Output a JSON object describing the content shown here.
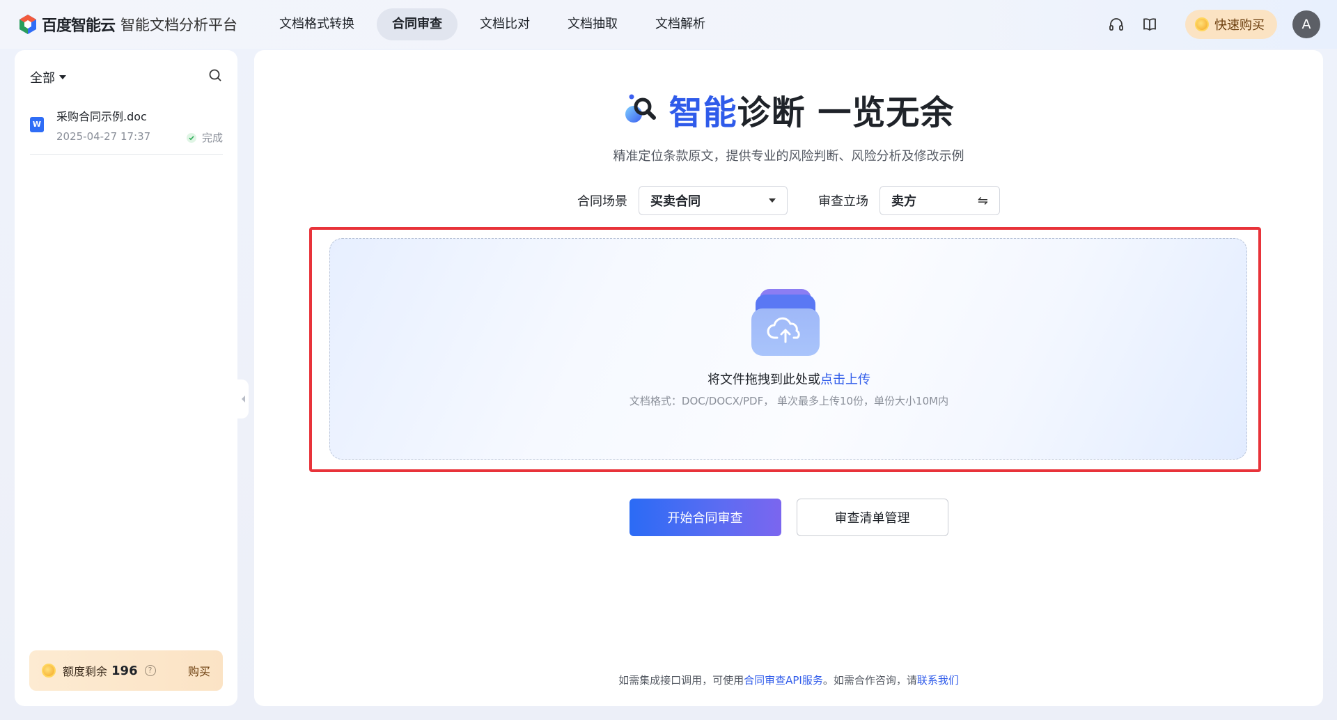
{
  "header": {
    "brand_name": "百度智能云",
    "brand_sub": "智能文档分析平台",
    "nav": [
      {
        "label": "文档格式转换",
        "active": false
      },
      {
        "label": "合同审查",
        "active": true
      },
      {
        "label": "文档比对",
        "active": false
      },
      {
        "label": "文档抽取",
        "active": false
      },
      {
        "label": "文档解析",
        "active": false
      }
    ],
    "icons": [
      "headset-icon",
      "book-icon"
    ],
    "buy_label": "快速购买",
    "avatar_letter": "A"
  },
  "sidebar": {
    "filter_label": "全部",
    "documents": [
      {
        "name": "采购合同示例.doc",
        "time": "2025-04-27 17:37",
        "status": "完成",
        "type_badge": "W"
      }
    ],
    "quota": {
      "label": "额度剩余",
      "value": "196",
      "buy_label": "购买"
    }
  },
  "main": {
    "title_accent": "智能",
    "title_rest": "诊断 一览无余",
    "subtitle": "精准定位条款原文，提供专业的风险判断、风险分析及修改示例",
    "scene_label": "合同场景",
    "scene_value": "买卖合同",
    "stance_label": "审查立场",
    "stance_value": "卖方",
    "swap_glyph": "⇋",
    "upload": {
      "text": "将文件拖拽到此处或",
      "link": "点击上传",
      "hint": "文档格式：DOC/DOCX/PDF， 单次最多上传10份，单份大小10M内"
    },
    "start_button": "开始合同审查",
    "checklist_button": "审查清单管理",
    "footer": {
      "prefix": "如需集成接口调用，可使用",
      "api_link": "合同审查API服务",
      "middle": "。如需合作咨询，请",
      "contact_link": "联系我们"
    }
  },
  "colors": {
    "accent": "#2f5bea",
    "highlight_border": "#e8333a",
    "buy_bg": "#fbe3c3"
  }
}
